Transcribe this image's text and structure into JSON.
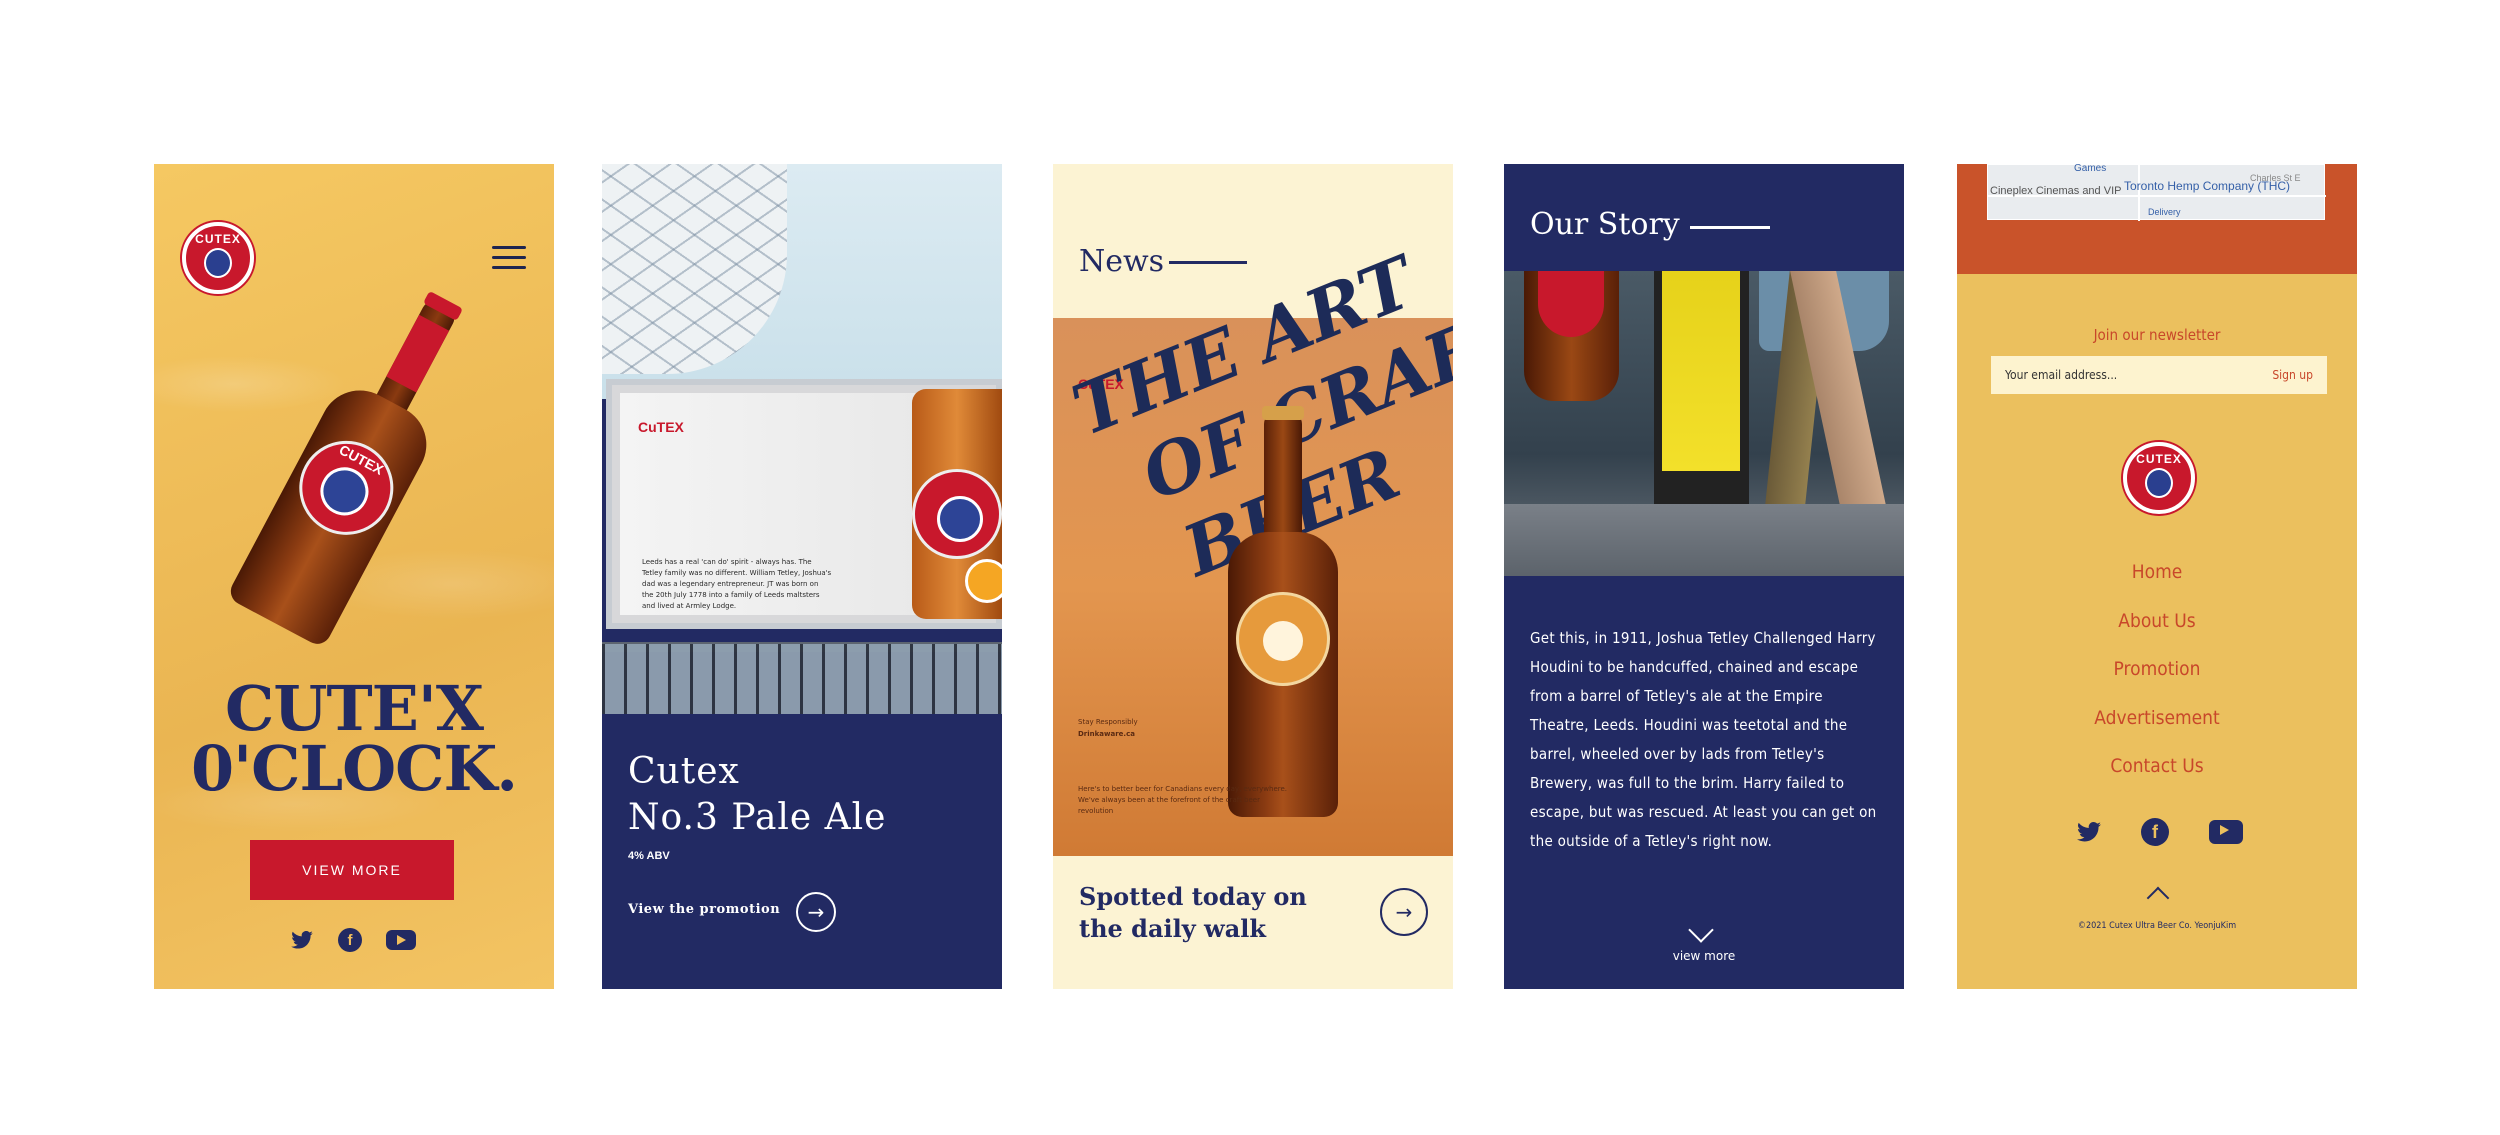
{
  "colors": {
    "navy": "#222a63",
    "red": "#c8182c",
    "yellow": "#f2c05c",
    "cream": "#fcf3d3",
    "orange": "#c9532a"
  },
  "panel1": {
    "logo_text": "CUTEX",
    "hero_title_line1": "CUTE'X",
    "hero_title_line2": "0'CLOCK.",
    "view_more_label": "VIEW MORE",
    "bottle_label": "CUTEX",
    "socials": {
      "twitter": "twitter-icon",
      "facebook": "facebook-icon",
      "youtube": "youtube-icon"
    }
  },
  "panel2": {
    "board_logo": "CuTEX",
    "board_text": "Leeds has a real 'can do' spirit - always has. The Tetley family was no different. William Tetley, Joshua's dad was a legendary entrepreneur. JT was born on the 20th July 1778 into a family of Leeds maltsters and lived at Armley Lodge.",
    "title_line1": "Cutex",
    "title_line2": "No.3 Pale Ale",
    "abv": "4% ABV",
    "link_label": "View the promotion",
    "arrow": "→"
  },
  "panel3": {
    "section_title": "News",
    "mini_logo": "CuTEX",
    "art_text": [
      "THE ART",
      "OF CRAFT",
      "BEER"
    ],
    "small_line1": "Stay Responsibly",
    "small_line2": "Drinkaware.ca",
    "small_text": "Here's to better beer for Canadians every day, everywhere. We've always been at the forefront of the craft beer revolution",
    "caption_line1": "Spotted today on",
    "caption_line2": "the daily walk",
    "arrow": "→"
  },
  "panel4": {
    "section_title": "Our Story",
    "story": "Get this, in 1911, Joshua Tetley Challenged Harry Houdini to be handcuffed, chained and escape from a barrel of Tetley's ale at the Empire Theatre, Leeds. Houdini was teetotal and the barrel, wheeled over by lads from Tetley's Brewery, was full to the brim. Harry failed to escape, but was rescued. At least you can get on the outside of a Tetley's right now.",
    "view_more": "view more"
  },
  "panel5": {
    "map_labels": [
      "Toronto Hemp Company (THC)",
      "Cineplex Cinemas and VIP",
      "Delivery",
      "Charles St E",
      "Games"
    ],
    "newsletter_label": "Join our newsletter",
    "email_placeholder": "Your email address...",
    "signup_label": "Sign up",
    "logo_text": "CUTEX",
    "nav": [
      "Home",
      "About Us",
      "Promotion",
      "Advertisement",
      "Contact Us"
    ],
    "copyright": "©2021 Cutex Ultra Beer Co. YeonjuKim"
  }
}
